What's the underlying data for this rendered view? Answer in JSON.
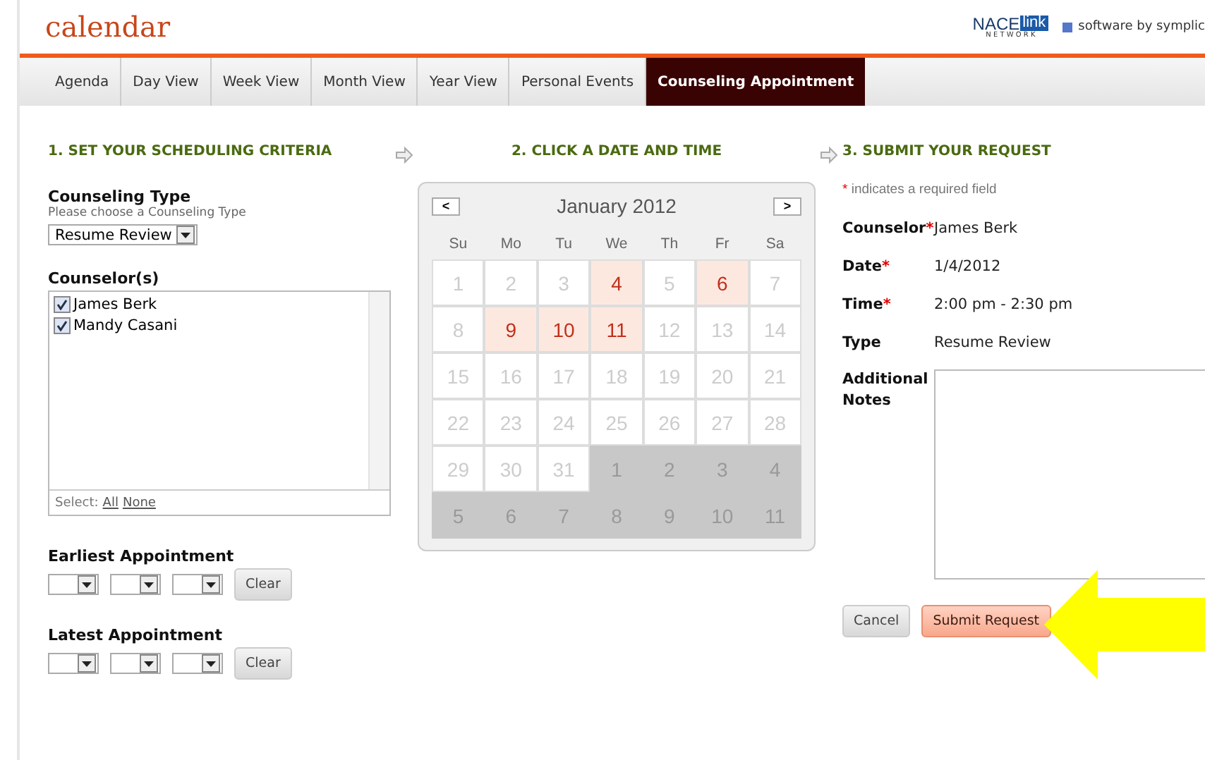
{
  "header": {
    "title": "calendar",
    "logo": {
      "part_1": "NACE",
      "part_2": "link",
      "sub": "N E T W O R K"
    },
    "credit": "software by symplic"
  },
  "tabs": [
    {
      "label": "Agenda",
      "selected": false
    },
    {
      "label": "Day View",
      "selected": false
    },
    {
      "label": "Week View",
      "selected": false
    },
    {
      "label": "Month View",
      "selected": false
    },
    {
      "label": "Year View",
      "selected": false
    },
    {
      "label": "Personal Events",
      "selected": false
    },
    {
      "label": "Counseling Appointment",
      "selected": true
    }
  ],
  "step_1": {
    "heading": "1. SET YOUR SCHEDULING CRITERIA",
    "counseling_type": {
      "label": "Counseling Type",
      "hint": "Please choose a Counseling Type",
      "value": "Resume Review"
    },
    "counselors": {
      "label": "Counselor(s)",
      "items": [
        {
          "name": "James Berk",
          "checked": true
        },
        {
          "name": "Mandy Casani",
          "checked": true
        }
      ],
      "select_label": "Select:",
      "select_all": "All",
      "select_none": "None"
    },
    "earliest": {
      "label": "Earliest Appointment",
      "clear": "Clear"
    },
    "latest": {
      "label": "Latest Appointment",
      "clear": "Clear"
    }
  },
  "step_2": {
    "heading": "2. CLICK A DATE AND TIME",
    "calendar": {
      "month": "January 2012",
      "prev": "<",
      "next": ">",
      "weekdays": [
        "Su",
        "Mo",
        "Tu",
        "We",
        "Th",
        "Fr",
        "Sa"
      ],
      "days": [
        {
          "label": "1",
          "kind": "normal"
        },
        {
          "label": "2",
          "kind": "normal"
        },
        {
          "label": "3",
          "kind": "normal"
        },
        {
          "label": "4",
          "kind": "available"
        },
        {
          "label": "5",
          "kind": "normal"
        },
        {
          "label": "6",
          "kind": "available"
        },
        {
          "label": "7",
          "kind": "normal"
        },
        {
          "label": "8",
          "kind": "normal"
        },
        {
          "label": "9",
          "kind": "available"
        },
        {
          "label": "10",
          "kind": "available"
        },
        {
          "label": "11",
          "kind": "available"
        },
        {
          "label": "12",
          "kind": "normal"
        },
        {
          "label": "13",
          "kind": "normal"
        },
        {
          "label": "14",
          "kind": "normal"
        },
        {
          "label": "15",
          "kind": "normal"
        },
        {
          "label": "16",
          "kind": "normal"
        },
        {
          "label": "17",
          "kind": "normal"
        },
        {
          "label": "18",
          "kind": "normal"
        },
        {
          "label": "19",
          "kind": "normal"
        },
        {
          "label": "20",
          "kind": "normal"
        },
        {
          "label": "21",
          "kind": "normal"
        },
        {
          "label": "22",
          "kind": "normal"
        },
        {
          "label": "23",
          "kind": "normal"
        },
        {
          "label": "24",
          "kind": "normal"
        },
        {
          "label": "25",
          "kind": "normal"
        },
        {
          "label": "26",
          "kind": "normal"
        },
        {
          "label": "27",
          "kind": "normal"
        },
        {
          "label": "28",
          "kind": "normal"
        },
        {
          "label": "29",
          "kind": "normal"
        },
        {
          "label": "30",
          "kind": "normal"
        },
        {
          "label": "31",
          "kind": "normal"
        },
        {
          "label": "1",
          "kind": "other"
        },
        {
          "label": "2",
          "kind": "other"
        },
        {
          "label": "3",
          "kind": "other"
        },
        {
          "label": "4",
          "kind": "other"
        },
        {
          "label": "5",
          "kind": "other"
        },
        {
          "label": "6",
          "kind": "other"
        },
        {
          "label": "7",
          "kind": "other"
        },
        {
          "label": "8",
          "kind": "other"
        },
        {
          "label": "9",
          "kind": "other"
        },
        {
          "label": "10",
          "kind": "other"
        },
        {
          "label": "11",
          "kind": "other"
        }
      ]
    }
  },
  "step_3": {
    "heading": "3. SUBMIT YOUR REQUEST",
    "required_mark": "*",
    "required_note": "indicates a required field",
    "fields": [
      {
        "label": "Counselor",
        "required": true,
        "value": "James Berk"
      },
      {
        "label": "Date",
        "required": true,
        "value": "1/4/2012"
      },
      {
        "label": "Time",
        "required": true,
        "value": "2:00 pm - 2:30 pm"
      },
      {
        "label": "Type",
        "required": false,
        "value": "Resume Review"
      }
    ],
    "notes_label": "Additional Notes",
    "cancel": "Cancel",
    "submit": "Submit Request"
  }
}
